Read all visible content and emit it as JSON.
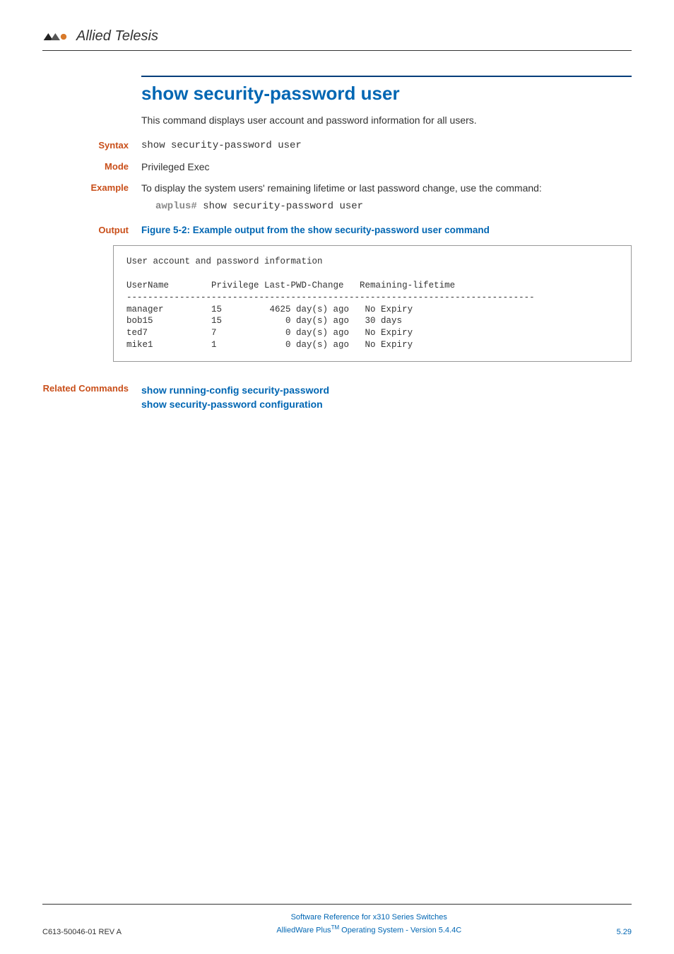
{
  "brand": "Allied Telesis",
  "title": "show security-password user",
  "description": "This command displays user account and password information for all users.",
  "syntax": {
    "label": "Syntax",
    "value": "show security-password user"
  },
  "mode": {
    "label": "Mode",
    "value": "Privileged Exec"
  },
  "example": {
    "label": "Example",
    "text": "To display the system users' remaining lifetime or last password change, use the command:",
    "prompt": "awplus#",
    "cmd": " show security-password user"
  },
  "output": {
    "label": "Output",
    "heading": "Figure 5-2: Example output from the show security-password user command",
    "text": "User account and password information\n\nUserName        Privilege Last-PWD-Change   Remaining-lifetime\n-----------------------------------------------------------------------------\nmanager         15         4625 day(s) ago   No Expiry\nbob15           15            0 day(s) ago   30 days\nted7            7             0 day(s) ago   No Expiry\nmike1           1             0 day(s) ago   No Expiry"
  },
  "related": {
    "label": "Related Commands",
    "links": [
      "show running-config security-password",
      "show security-password configuration"
    ]
  },
  "footer": {
    "left": "C613-50046-01 REV A",
    "center1": "Software Reference for x310 Series Switches",
    "center2a": "AlliedWare Plus",
    "center2b": " Operating System - Version 5.4.4C",
    "right": "5.29"
  }
}
